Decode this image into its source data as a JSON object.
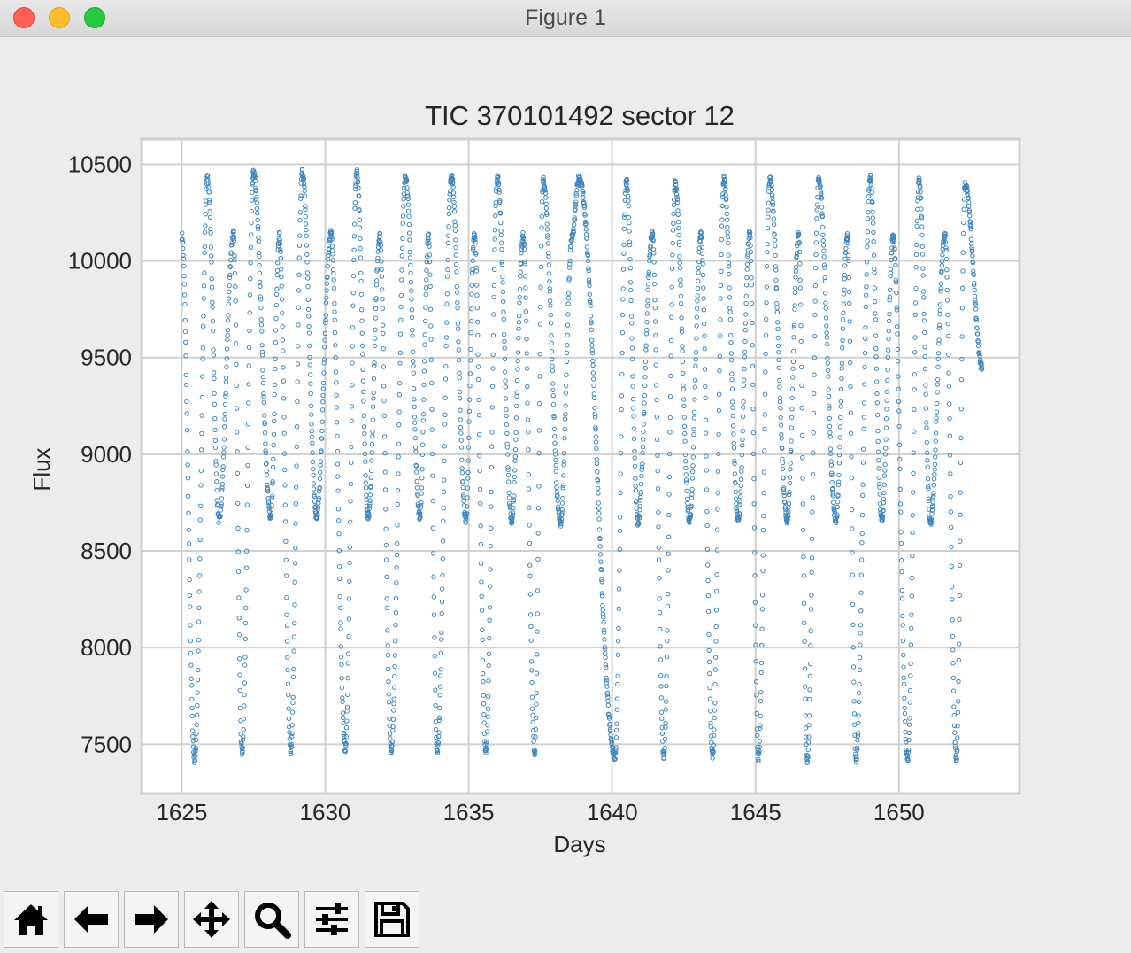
{
  "window": {
    "title": "Figure 1"
  },
  "toolbar": {
    "buttons": [
      {
        "name": "home-button",
        "icon": "home-icon"
      },
      {
        "name": "back-button",
        "icon": "arrow-left-icon"
      },
      {
        "name": "forward-button",
        "icon": "arrow-right-icon"
      },
      {
        "name": "pan-button",
        "icon": "move-icon"
      },
      {
        "name": "zoom-button",
        "icon": "magnifier-icon"
      },
      {
        "name": "configure-subplots-button",
        "icon": "sliders-icon"
      },
      {
        "name": "save-button",
        "icon": "floppy-icon"
      }
    ]
  },
  "colors": {
    "marker": "#3f85bd",
    "grid": "#d0d0d0",
    "axes_frame": "#cfcfcf",
    "text": "#262626"
  },
  "chart_data": {
    "type": "scatter",
    "title": "TIC 370101492 sector 12",
    "xlabel": "Days",
    "ylabel": "Flux",
    "xlim": [
      1623.6,
      1654.2
    ],
    "ylim": [
      7245,
      10630
    ],
    "xticks": [
      1625,
      1630,
      1635,
      1640,
      1645,
      1650
    ],
    "yticks": [
      7500,
      8000,
      8500,
      9000,
      9500,
      10000,
      10500
    ],
    "grid": true,
    "marker": "open-circle",
    "series": [
      {
        "description_type": "light curve of a pulsating star (open circle markers)",
        "segments": [
          {
            "start": 1624.98,
            "end": 1638.88
          },
          {
            "start": 1640.0,
            "end": 1652.95
          }
        ],
        "x": [
          1625.0,
          1625.45,
          1625.9,
          1626.3,
          1626.8,
          1627.1,
          1627.5,
          1628.1,
          1628.4,
          1628.8,
          1629.2,
          1629.7,
          1630.2,
          1630.7,
          1631.1,
          1631.5,
          1631.9,
          1632.3,
          1632.8,
          1633.3,
          1633.6,
          1633.9,
          1634.4,
          1634.9,
          1635.2,
          1635.6,
          1636.0,
          1636.5,
          1636.9,
          1637.3,
          1637.6,
          1638.2,
          1638.6,
          1638.85,
          1640.1,
          1640.5,
          1640.9,
          1641.4,
          1641.8,
          1642.2,
          1642.7,
          1643.1,
          1643.5,
          1643.9,
          1644.4,
          1644.8,
          1645.1,
          1645.5,
          1646.1,
          1646.5,
          1646.8,
          1647.2,
          1647.8,
          1648.2,
          1648.5,
          1649.0,
          1649.4,
          1649.8,
          1650.3,
          1650.7,
          1651.1,
          1651.6,
          1652.0,
          1652.3,
          1652.9
        ],
        "y": [
          10130,
          7420,
          10430,
          8660,
          10140,
          7460,
          10450,
          8680,
          10130,
          7470,
          10460,
          8680,
          10140,
          7480,
          10460,
          8670,
          10130,
          7470,
          10440,
          8680,
          10130,
          7460,
          10440,
          8660,
          10140,
          7460,
          10430,
          8660,
          10130,
          7460,
          10420,
          8640,
          10120,
          10430,
          7440,
          10410,
          8650,
          10140,
          7440,
          10400,
          8660,
          10140,
          7440,
          10420,
          8660,
          10140,
          7430,
          10420,
          8660,
          10130,
          7420,
          10420,
          8660,
          10130,
          7420,
          10430,
          8660,
          10130,
          7420,
          10420,
          8650,
          10130,
          7420,
          10400,
          9450
        ],
        "pulsation_pattern": {
          "maxima_high": 10450,
          "maxima_low": 10140,
          "minima_deep": 7430,
          "minima_shallow": 8660
        }
      }
    ]
  }
}
